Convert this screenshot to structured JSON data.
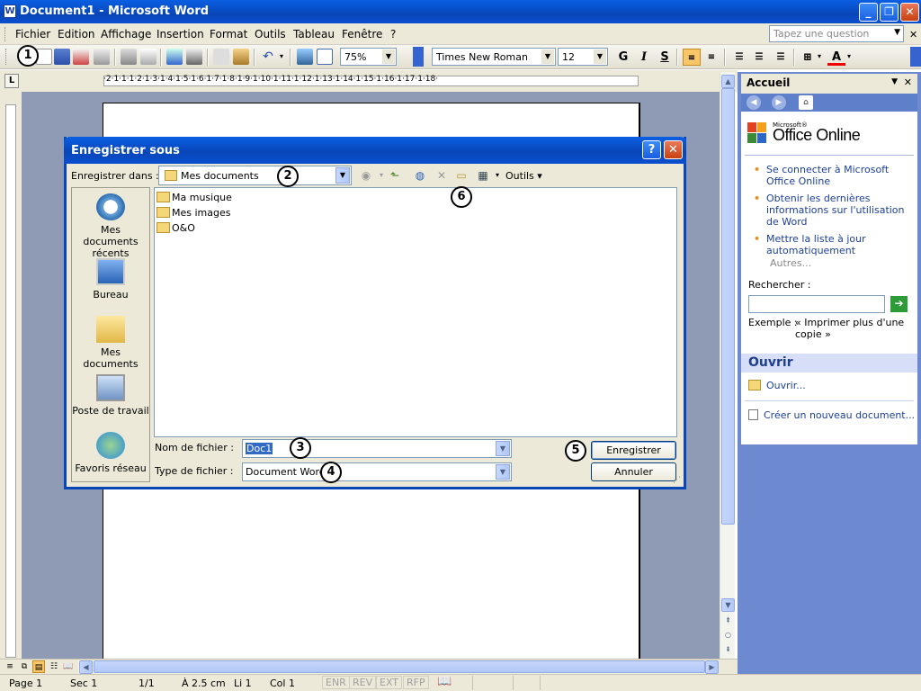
{
  "window": {
    "title": "Document1 - Microsoft Word",
    "minimize": "_",
    "restore": "❐",
    "close": "✕"
  },
  "menu": {
    "items": [
      "Fichier",
      "Edition",
      "Affichage",
      "Insertion",
      "Format",
      "Outils",
      "Tableau",
      "Fenêtre",
      "?"
    ],
    "ask_placeholder": "Tapez une question",
    "close_doc": "✕"
  },
  "toolbar": {
    "zoom": "75%",
    "font": "Times New Roman",
    "size": "12",
    "bold": "G",
    "italic": "I",
    "strike": "S",
    "font_color_letter": "A"
  },
  "callouts": [
    "1",
    "2",
    "3",
    "4",
    "5",
    "6"
  ],
  "ruler": {
    "tab_selector": "L",
    "numbers": "·2·1·1·1·2·1·3·1·4·1·5·1·6·1·7·1·8·1·9·1·10·1·11·1·12·1·13·1·14·1·15·1·16·1·17·1·18·"
  },
  "dialog": {
    "title": "Enregistrer sous",
    "help": "?",
    "close": "✕",
    "save_in_label": "Enregistrer dans :",
    "save_in_value": "Mes documents",
    "tools_label": "Outils ▾",
    "places": [
      "Mes documents récents",
      "Bureau",
      "Mes documents",
      "Poste de travail",
      "Favoris réseau"
    ],
    "files": [
      "Ma musique",
      "Mes images",
      "O&O"
    ],
    "filename_label": "Nom de fichier :",
    "filename_value": "Doc1",
    "filetype_label": "Type de fichier :",
    "filetype_value": "Document Word",
    "save_button": "Enregistrer",
    "cancel_button": "Annuler"
  },
  "taskpane": {
    "title": "Accueil",
    "logo_small": "Microsoft®",
    "logo_text": "Office Online",
    "links": [
      "Se connecter à Microsoft Office Online",
      "Obtenir les dernières informations sur l'utilisation de Word",
      "Mettre la liste à jour automatiquement"
    ],
    "more": "Autres...",
    "search_label": "Rechercher :",
    "go": "➔",
    "example_label": "Exemple :",
    "example_value": "« Imprimer plus d'une copie »",
    "open_header": "Ouvrir",
    "open_link": "Ouvrir...",
    "new_doc_link": "Créer un nouveau document..."
  },
  "status": {
    "page": "Page  1",
    "sec": "Sec  1",
    "pages": "1/1",
    "at": "À  2.5 cm",
    "line": "Li  1",
    "col": "Col  1",
    "enr": "ENR",
    "rev": "REV",
    "ext": "EXT",
    "rfp": "RFP"
  }
}
